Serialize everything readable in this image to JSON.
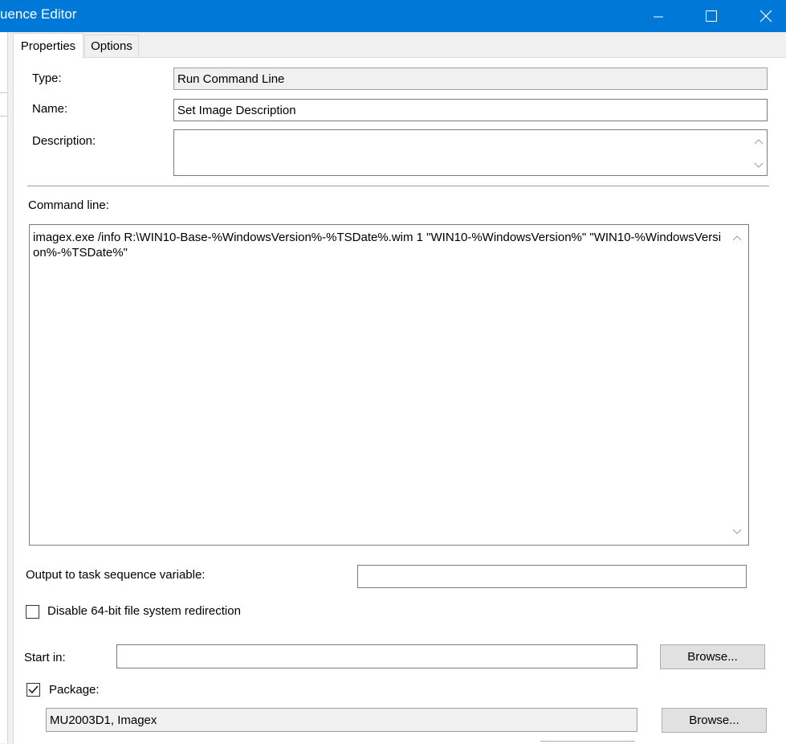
{
  "window": {
    "title": "uence Editor",
    "controls": {
      "minimize": "minimize-icon",
      "maximize": "maximize-icon",
      "close": "close-icon"
    }
  },
  "tabs": [
    {
      "label": "Properties",
      "active": true
    },
    {
      "label": "Options",
      "active": false
    }
  ],
  "form": {
    "type_label": "Type:",
    "type_value": "Run Command Line",
    "name_label": "Name:",
    "name_value": "Set Image Description",
    "description_label": "Description:",
    "description_value": "",
    "command_line_label": "Command line:",
    "command_line_value": "imagex.exe /info R:\\WIN10-Base-%WindowsVersion%-%TSDate%.wim 1 \"WIN10-%WindowsVersion%\" \"WIN10-%WindowsVersion%-%TSDate%\"",
    "output_label": "Output to task sequence variable:",
    "output_value": "",
    "disable_redirection_label": "Disable 64-bit file system redirection",
    "disable_redirection_checked": false,
    "start_in_label": "Start in:",
    "start_in_value": "",
    "browse_label": "Browse...",
    "package_label": "Package:",
    "package_checked": true,
    "package_value": "MU2003D1, Imagex",
    "package_browse_label": "Browse..."
  },
  "colors": {
    "titlebar": "#0078d7",
    "window_bg": "#f0f0f0"
  }
}
